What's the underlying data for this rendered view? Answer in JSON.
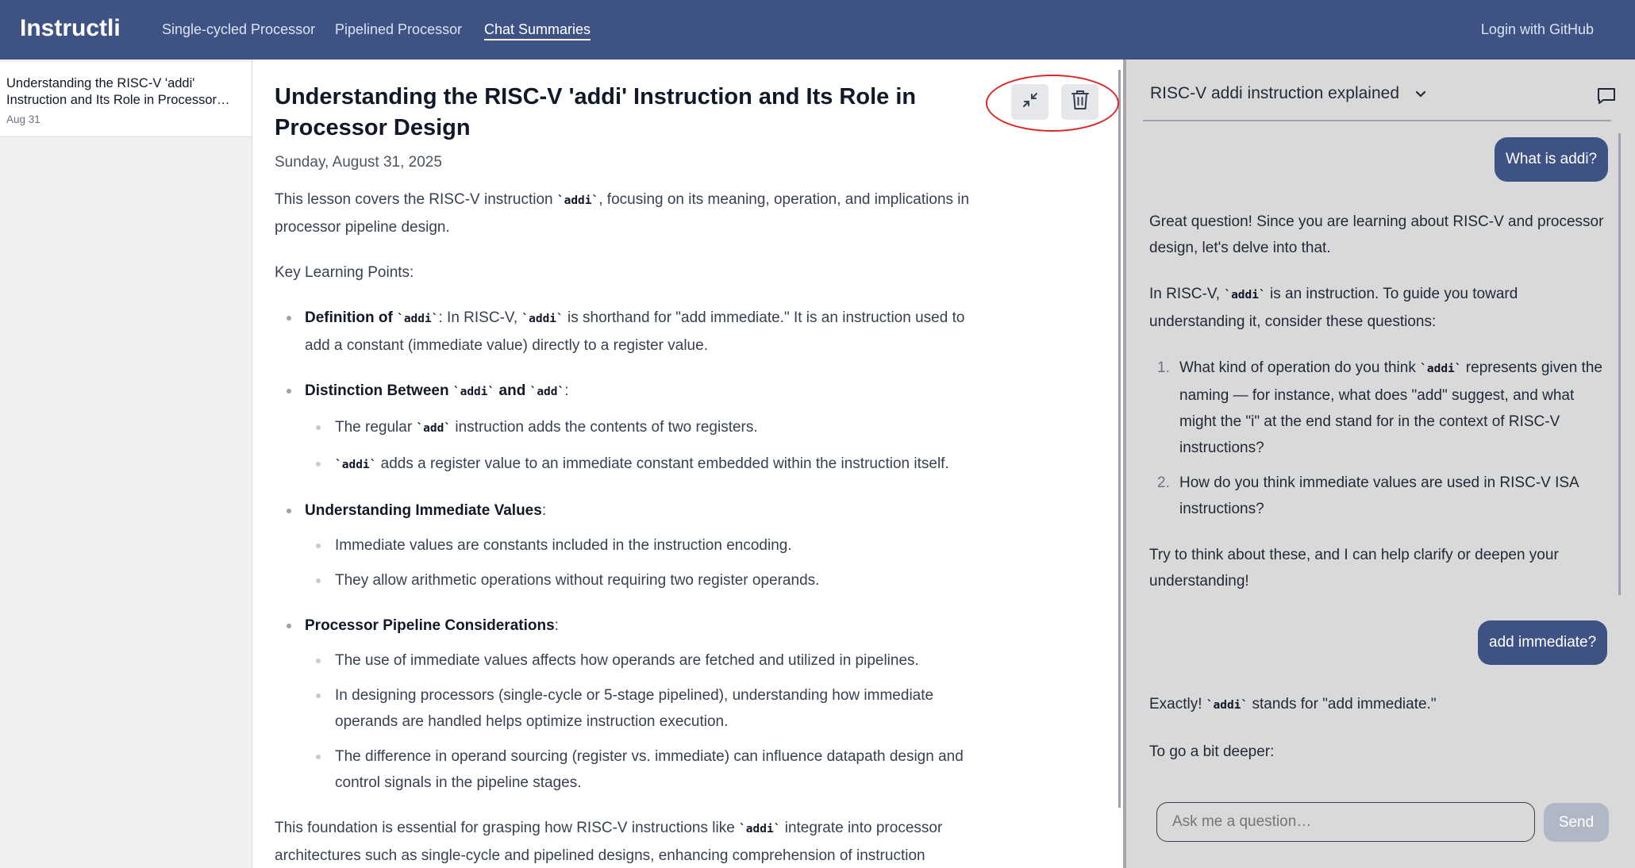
{
  "nav": {
    "brand": "Instructli",
    "links": [
      "Single-cycled Processor",
      "Pipelined Processor",
      "Chat Summaries"
    ],
    "login": "Login with GitHub"
  },
  "sidebar": {
    "items": [
      {
        "title": "Understanding the RISC-V 'addi' Instruction and Its Role in Processor…",
        "date": "Aug 31"
      }
    ]
  },
  "article": {
    "title": "Understanding the RISC-V 'addi' Instruction and Its Role in Processor Design",
    "date": "Sunday, August 31, 2025",
    "intro_pre": "This lesson covers the RISC-V instruction ",
    "intro_code": "`addi`",
    "intro_post": ", focusing on its meaning, operation, and implications in processor pipeline design.",
    "key_points_label": "Key Learning Points:",
    "b1_label": "Definition of ",
    "b1_code": "`addi`",
    "b1_colon": ":",
    "b1_text_pre": " In RISC-V, ",
    "b1_text_code": "`addi`",
    "b1_text_post": " is shorthand for \"add immediate.\" It is an instruction used to add a constant (immediate value) directly to a register value.",
    "b2_label_pre": "Distinction Between ",
    "b2_code1": "`addi`",
    "b2_and": " and ",
    "b2_code2": "`add`",
    "b2_colon": ":",
    "b2_sub1_pre": "The regular ",
    "b2_sub1_code": "`add`",
    "b2_sub1_post": " instruction adds the contents of two registers.",
    "b2_sub2_code": "`addi`",
    "b2_sub2_post": " adds a register value to an immediate constant embedded within the instruction itself.",
    "b3_label": "Understanding Immediate Values",
    "b3_colon": ":",
    "b3_sub1": "Immediate values are constants included in the instruction encoding.",
    "b3_sub2": "They allow arithmetic operations without requiring two register operands.",
    "b4_label": "Processor Pipeline Considerations",
    "b4_colon": ":",
    "b4_sub1": "The use of immediate values affects how operands are fetched and utilized in pipelines.",
    "b4_sub2": "In designing processors (single-cycle or 5-stage pipelined), understanding how immediate operands are handled helps optimize instruction execution.",
    "b4_sub3": "The difference in operand sourcing (register vs. immediate) can influence datapath design and control signals in the pipeline stages.",
    "outro_pre": "This foundation is essential for grasping how RISC-V instructions like ",
    "outro_code": "`addi`",
    "outro_post": " integrate into processor architectures such as single-cycle and pipelined designs, enhancing comprehension of instruction"
  },
  "actions": {
    "collapse_icon": "collapse-icon",
    "delete_icon": "trash-icon",
    "highlight_color": "#dc2626"
  },
  "chat": {
    "title": "RISC-V addi instruction explained",
    "user_msg_1": "What is addi?",
    "reply1_p1": "Great question! Since you are learning about RISC-V and processor design, let's delve into that.",
    "reply1_p2_pre": "In RISC-V, ",
    "reply1_p2_code": "`addi`",
    "reply1_p2_post": " is an instruction. To guide you toward understanding it, consider these questions:",
    "reply1_q1_num": "1.",
    "reply1_q1_pre": "What kind of operation do you think ",
    "reply1_q1_code": "`addi`",
    "reply1_q1_post": " represents given the naming — for instance, what does \"add\" suggest, and what might the \"i\" at the end stand for in the context of RISC-V instructions?",
    "reply1_q2_num": "2.",
    "reply1_q2": "How do you think immediate values are used in RISC-V ISA instructions?",
    "reply1_p3": "Try to think about these, and I can help clarify or deepen your understanding!",
    "user_msg_2": "add immediate?",
    "reply2_p1_pre": "Exactly! ",
    "reply2_p1_code": "`addi`",
    "reply2_p1_post": " stands for \"add immediate.\"",
    "reply2_p2": "To go a bit deeper:",
    "input_placeholder": "Ask me a question…",
    "send_label": "Send"
  },
  "colors": {
    "nav_bg": "#3e5384",
    "user_bubble": "#3e5384",
    "chat_bg": "#d9d9d9"
  }
}
